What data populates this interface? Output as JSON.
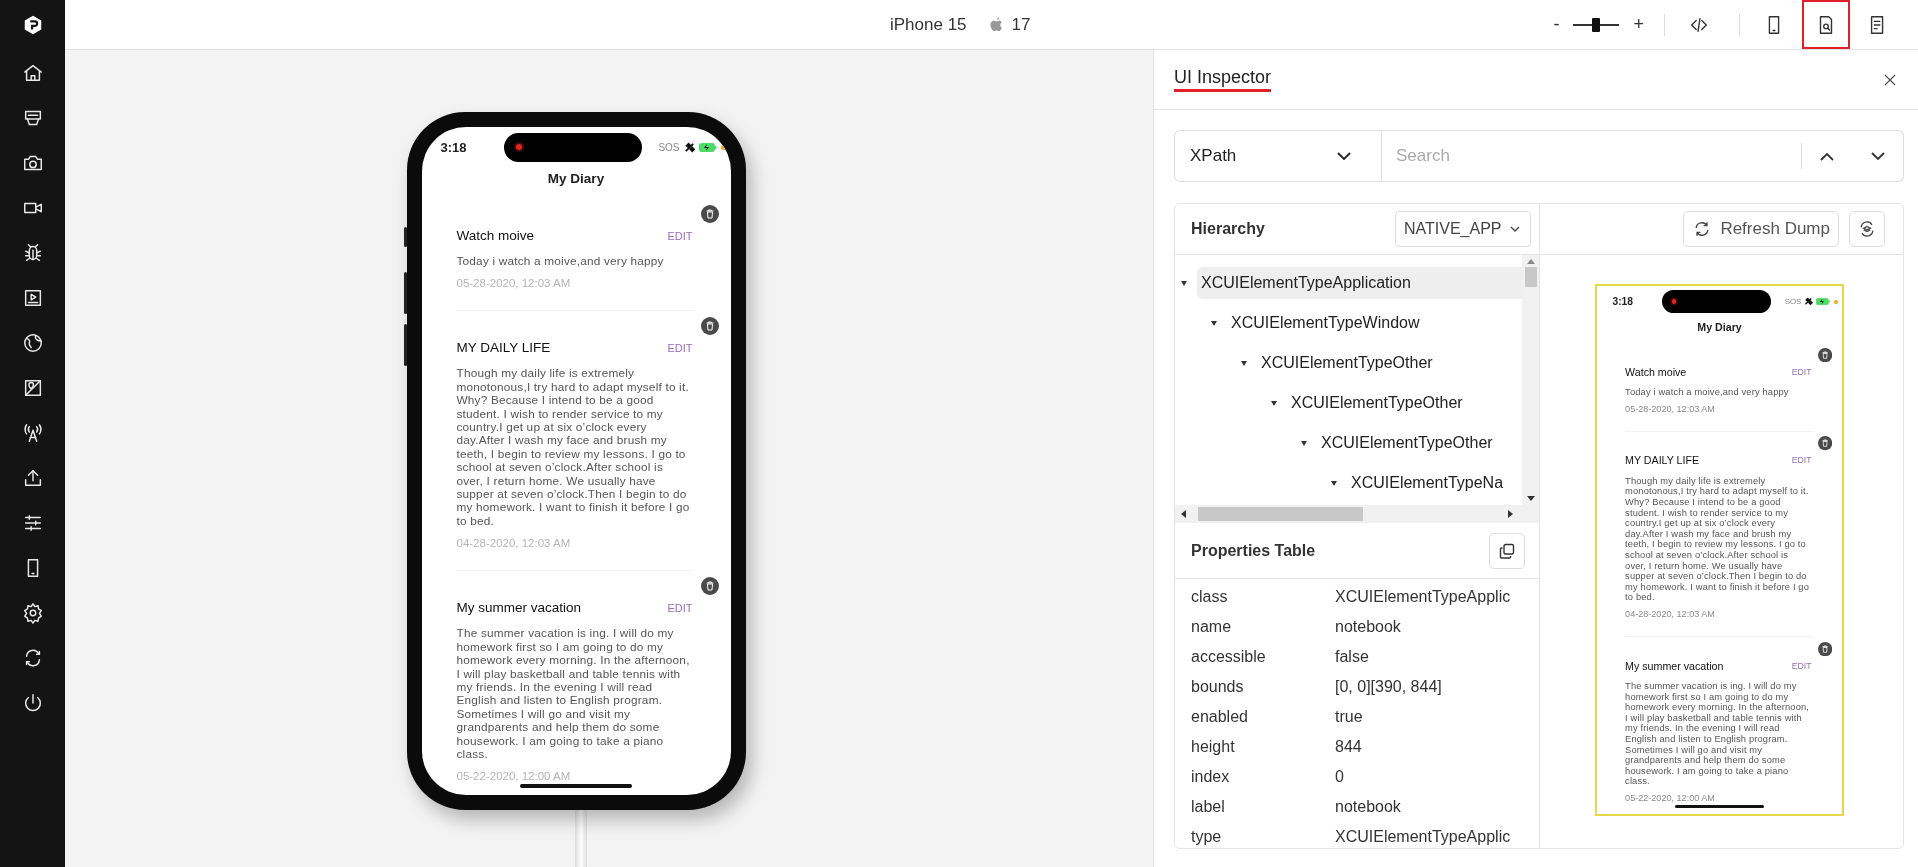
{
  "sidebar": {
    "items": [
      {
        "kind": "home"
      },
      {
        "kind": "app"
      },
      {
        "kind": "camera"
      },
      {
        "kind": "video"
      },
      {
        "kind": "bug"
      },
      {
        "kind": "media"
      },
      {
        "kind": "globe"
      },
      {
        "kind": "location"
      },
      {
        "kind": "antenna"
      },
      {
        "kind": "upload"
      },
      {
        "kind": "sliders"
      },
      {
        "kind": "device"
      },
      {
        "kind": "settings"
      },
      {
        "kind": "sync"
      },
      {
        "kind": "power"
      }
    ]
  },
  "topbar": {
    "device": "iPhone 15",
    "os_version": "17",
    "zoom": {
      "minus": "-",
      "plus": "+",
      "level": 0.5
    },
    "tools": [
      {
        "kind": "code",
        "selected": false
      },
      {
        "kind": "device",
        "selected": false
      },
      {
        "kind": "inspector",
        "selected": true
      },
      {
        "kind": "report",
        "selected": false
      }
    ]
  },
  "device": {
    "screen": {
      "time": "3:18",
      "status_text": "SOS",
      "title": "My Diary",
      "entries": [
        {
          "title": "Watch moive",
          "edit": "EDIT",
          "body": "Today i watch a moive,and very happy",
          "date": "05-28-2020, 12:03 AM"
        },
        {
          "title": "MY DAILY LIFE",
          "edit": "EDIT",
          "body": "Though my daily life is extremely monotonous,I try hard to adapt myself to it. Why? Because I intend to be a good student. I wish to render service to my country.I get up at six o’clock every day.After I wash my face and brush my teeth, I begin to review my lessons. I go to school at seven o’clock.After school is over, I return home. We usually have supper at seven o’clock.Then I begin to do my homework. I want to finish it before I go to bed.",
          "date": "04-28-2020, 12:03 AM"
        },
        {
          "title": "My summer vacation",
          "edit": "EDIT",
          "body": "The summer vacation is ing. I will do my homework first so I am going to do my homework every morning. In the afternoon, I will play basketball and table tennis with my friends. In the evening I will read English and listen to English program. Sometimes I will go and visit my grandparents and help them do some housework. I am going to take a piano class.",
          "date": "05-22-2020, 12:00 AM"
        }
      ]
    }
  },
  "inspector": {
    "title": "UI Inspector",
    "search": {
      "mode": "XPath",
      "placeholder": "Search"
    },
    "hierarchy": {
      "title": "Hierarchy",
      "context": "NATIVE_APP",
      "tree": [
        {
          "label": "XCUIElementTypeApplication",
          "selected": true,
          "children": [
            {
              "label": "XCUIElementTypeWindow",
              "selected": false,
              "children": [
                {
                  "label": "XCUIElementTypeOther",
                  "selected": false,
                  "children": [
                    {
                      "label": "XCUIElementTypeOther",
                      "selected": false,
                      "children": [
                        {
                          "label": "XCUIElementTypeOther",
                          "selected": false,
                          "children": [
                            {
                              "label": "XCUIElementTypeNa",
                              "selected": false
                            }
                          ]
                        }
                      ]
                    }
                  ]
                }
              ]
            }
          ]
        }
      ]
    },
    "properties": {
      "title": "Properties Table",
      "rows": [
        {
          "key": "class",
          "value": "XCUIElementTypeApplic"
        },
        {
          "key": "name",
          "value": "notebook"
        },
        {
          "key": "accessible",
          "value": "false"
        },
        {
          "key": "bounds",
          "value": "[0, 0][390, 844]"
        },
        {
          "key": "enabled",
          "value": "true"
        },
        {
          "key": "height",
          "value": "844"
        },
        {
          "key": "index",
          "value": "0"
        },
        {
          "key": "label",
          "value": "notebook"
        },
        {
          "key": "type",
          "value": "XCUIElementTypeApplic"
        }
      ]
    },
    "refresh_button": "Refresh Dump",
    "preview": {
      "screen": {
        "time": "3:18",
        "status_text": "SOS",
        "title": "My Diary",
        "entries": [
          {
            "title": "Watch moive",
            "edit": "EDIT",
            "body": "Today i watch a moive,and very happy",
            "date": "05-28-2020, 12:03 AM"
          },
          {
            "title": "MY DAILY LIFE",
            "edit": "EDIT",
            "body": "Though my daily life is extremely monotonous,I try hard to adapt myself to it. Why? Because I intend to be a good student. I wish to render service to my country.I get up at six o’clock every day.After I wash my face and brush my teeth, I begin to review my lessons. I go to school at seven o’clock.After school is over, I return home. We usually have supper at seven o’clock.Then I begin to do my homework. I want to finish it before I go to bed.",
            "date": "04-28-2020, 12:03 AM"
          },
          {
            "title": "My summer vacation",
            "edit": "EDIT",
            "body": "The summer vacation is ing. I will do my homework first so I am going to do my homework every morning. In the afternoon, I will play basketball and table tennis with my friends. In the evening I will read English and listen to English program. Sometimes I will go and visit my grandparents and help them do some housework. I am going to take a piano class.",
            "date": "05-22-2020, 12:00 AM"
          }
        ]
      }
    }
  }
}
